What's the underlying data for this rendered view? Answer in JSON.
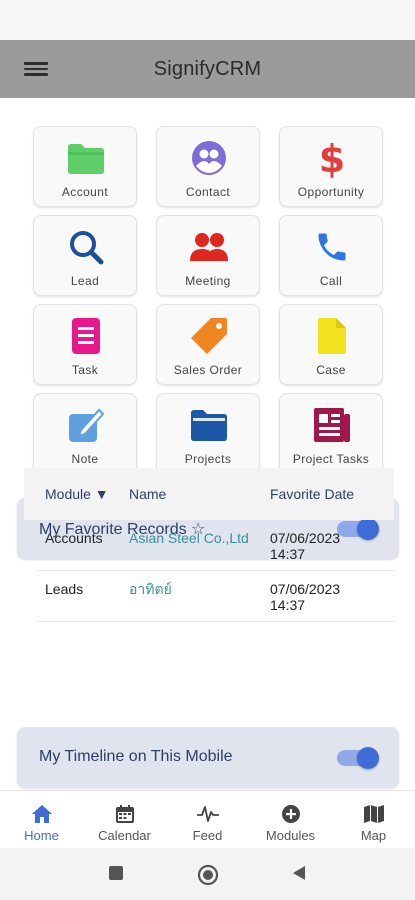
{
  "app": {
    "title": "SignifyCRM"
  },
  "modules": [
    {
      "label": "Account",
      "icon": "folder-icon",
      "color": "#5fcf6a"
    },
    {
      "label": "Contact",
      "icon": "contact-group-icon",
      "color": "#7e6cd9"
    },
    {
      "label": "Opportunity",
      "icon": "dollar-icon",
      "color": "#e23d3d"
    },
    {
      "label": "Lead",
      "icon": "search-icon",
      "color": "#1f4f9a"
    },
    {
      "label": "Meeting",
      "icon": "people-icon",
      "color": "#e0261f"
    },
    {
      "label": "Call",
      "icon": "phone-icon",
      "color": "#2b78e4"
    },
    {
      "label": "Task",
      "icon": "document-icon",
      "color": "#e6188b"
    },
    {
      "label": "Sales Order",
      "icon": "tag-icon",
      "color": "#f0861f"
    },
    {
      "label": "Case",
      "icon": "file-icon",
      "color": "#f2e21e"
    },
    {
      "label": "Note",
      "icon": "note-edit-icon",
      "color": "#5fa1de"
    },
    {
      "label": "Projects",
      "icon": "folder-open-icon",
      "color": "#1c58a6"
    },
    {
      "label": "Project Tasks",
      "icon": "newspaper-icon",
      "color": "#a0184b"
    }
  ],
  "favorites": {
    "title": "My Favorite Records",
    "star": "☆",
    "toggle_on": true,
    "columns": {
      "module": "Module ▼",
      "name": "Name",
      "date": "Favorite Date"
    },
    "rows": [
      {
        "module": "Accounts",
        "name": "Asian Steel Co.,Ltd",
        "date": "07/06/2023",
        "time": "14:37"
      },
      {
        "module": "Leads",
        "name": "อาทิตย์",
        "date": "07/06/2023",
        "time": "14:37"
      }
    ]
  },
  "timeline": {
    "title": "My Timeline on This Mobile",
    "toggle_on": true
  },
  "bottom_nav": [
    {
      "label": "Home",
      "icon": "home-icon",
      "active": true
    },
    {
      "label": "Calendar",
      "icon": "calendar-icon",
      "active": false
    },
    {
      "label": "Feed",
      "icon": "pulse-icon",
      "active": false
    },
    {
      "label": "Modules",
      "icon": "plus-circle-icon",
      "active": false
    },
    {
      "label": "Map",
      "icon": "map-icon",
      "active": false
    }
  ],
  "colors": {
    "accent": "#3f6cd6",
    "header_bg": "#9b9b9b",
    "section_bg": "#dfe4ef",
    "section_text": "#2f3d66",
    "link_teal": "#3a8f98"
  }
}
